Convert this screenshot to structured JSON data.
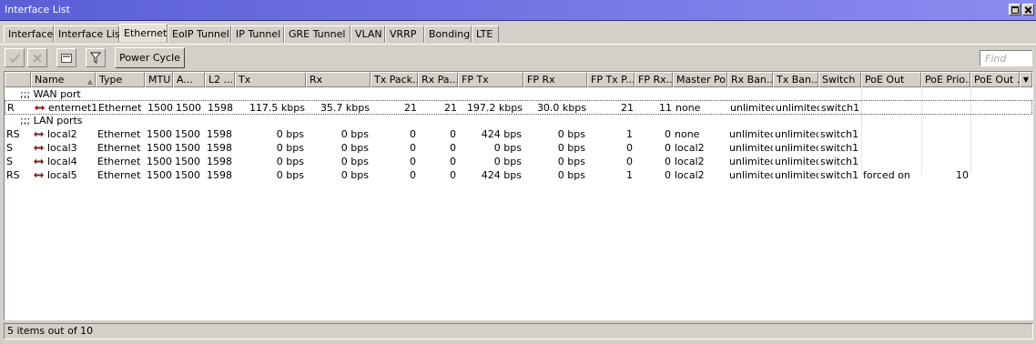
{
  "window": {
    "title": "Interface List"
  },
  "tabs": [
    {
      "label": "Interface"
    },
    {
      "label": "Interface List"
    },
    {
      "label": "Ethernet"
    },
    {
      "label": "EoIP Tunnel"
    },
    {
      "label": "IP Tunnel"
    },
    {
      "label": "GRE Tunnel"
    },
    {
      "label": "VLAN"
    },
    {
      "label": "VRRP"
    },
    {
      "label": "Bonding"
    },
    {
      "label": "LTE"
    }
  ],
  "active_tab": "Ethernet",
  "toolbar": {
    "enable_icon": "check-icon",
    "disable_icon": "x-icon",
    "comment_icon": "comment-icon",
    "filter_icon": "filter-icon",
    "power_cycle_label": "Power Cycle",
    "find_placeholder": "Find"
  },
  "table": {
    "columns": [
      "",
      "Name",
      "Type",
      "MTU",
      "A...",
      "L2 ...",
      "Tx",
      "Rx",
      "Tx Pack...",
      "Rx Pa...",
      "FP Tx",
      "FP Rx",
      "FP Tx P...",
      "FP Rx...",
      "Master Port",
      "Rx Ban...",
      "Tx Ban...",
      "Switch",
      "PoE Out",
      "PoE Prio...",
      "PoE Out ..."
    ],
    "sections": [
      {
        "comment": ";;; WAN port"
      },
      {
        "comment": ";;; LAN ports"
      }
    ],
    "rows": [
      {
        "flags": "R",
        "name": "enternet1",
        "type": "Ethernet",
        "mtu": "1500",
        "actual_mtu": "1500",
        "l2_mtu": "1598",
        "tx": "117.5 kbps",
        "rx": "35.7 kbps",
        "tx_packets": "21",
        "rx_packets": "21",
        "fp_tx": "197.2 kbps",
        "fp_rx": "30.0 kbps",
        "fp_tx_packets": "21",
        "fp_rx_packets": "11",
        "master_port": "none",
        "rx_bandwidth": "unlimited",
        "tx_bandwidth": "unlimited",
        "switch": "switch1",
        "poe_out": "",
        "poe_priority": "",
        "poe_out_status": ""
      },
      {
        "flags": "RS",
        "name": "local2",
        "type": "Ethernet",
        "mtu": "1500",
        "actual_mtu": "1500",
        "l2_mtu": "1598",
        "tx": "0 bps",
        "rx": "0 bps",
        "tx_packets": "0",
        "rx_packets": "0",
        "fp_tx": "424 bps",
        "fp_rx": "0 bps",
        "fp_tx_packets": "1",
        "fp_rx_packets": "0",
        "master_port": "none",
        "rx_bandwidth": "unlimited",
        "tx_bandwidth": "unlimited",
        "switch": "switch1",
        "poe_out": "",
        "poe_priority": "",
        "poe_out_status": ""
      },
      {
        "flags": "S",
        "name": "local3",
        "type": "Ethernet",
        "mtu": "1500",
        "actual_mtu": "1500",
        "l2_mtu": "1598",
        "tx": "0 bps",
        "rx": "0 bps",
        "tx_packets": "0",
        "rx_packets": "0",
        "fp_tx": "0 bps",
        "fp_rx": "0 bps",
        "fp_tx_packets": "0",
        "fp_rx_packets": "0",
        "master_port": "local2",
        "rx_bandwidth": "unlimited",
        "tx_bandwidth": "unlimited",
        "switch": "switch1",
        "poe_out": "",
        "poe_priority": "",
        "poe_out_status": ""
      },
      {
        "flags": "S",
        "name": "local4",
        "type": "Ethernet",
        "mtu": "1500",
        "actual_mtu": "1500",
        "l2_mtu": "1598",
        "tx": "0 bps",
        "rx": "0 bps",
        "tx_packets": "0",
        "rx_packets": "0",
        "fp_tx": "0 bps",
        "fp_rx": "0 bps",
        "fp_tx_packets": "0",
        "fp_rx_packets": "0",
        "master_port": "local2",
        "rx_bandwidth": "unlimited",
        "tx_bandwidth": "unlimited",
        "switch": "switch1",
        "poe_out": "",
        "poe_priority": "",
        "poe_out_status": ""
      },
      {
        "flags": "RS",
        "name": "local5",
        "type": "Ethernet",
        "mtu": "1500",
        "actual_mtu": "1500",
        "l2_mtu": "1598",
        "tx": "0 bps",
        "rx": "0 bps",
        "tx_packets": "0",
        "rx_packets": "0",
        "fp_tx": "424 bps",
        "fp_rx": "0 bps",
        "fp_tx_packets": "1",
        "fp_rx_packets": "0",
        "master_port": "local2",
        "rx_bandwidth": "unlimited",
        "tx_bandwidth": "unlimited",
        "switch": "switch1",
        "poe_out": "forced on",
        "poe_priority": "10",
        "poe_out_status": ""
      }
    ]
  },
  "status": {
    "text": "5 items out of 10"
  },
  "colors": {
    "titlebar_start": "#5a5ed8",
    "titlebar_end": "#8b8cf0",
    "window_bg": "#d4d0c8",
    "icon_red": "#c00000"
  }
}
